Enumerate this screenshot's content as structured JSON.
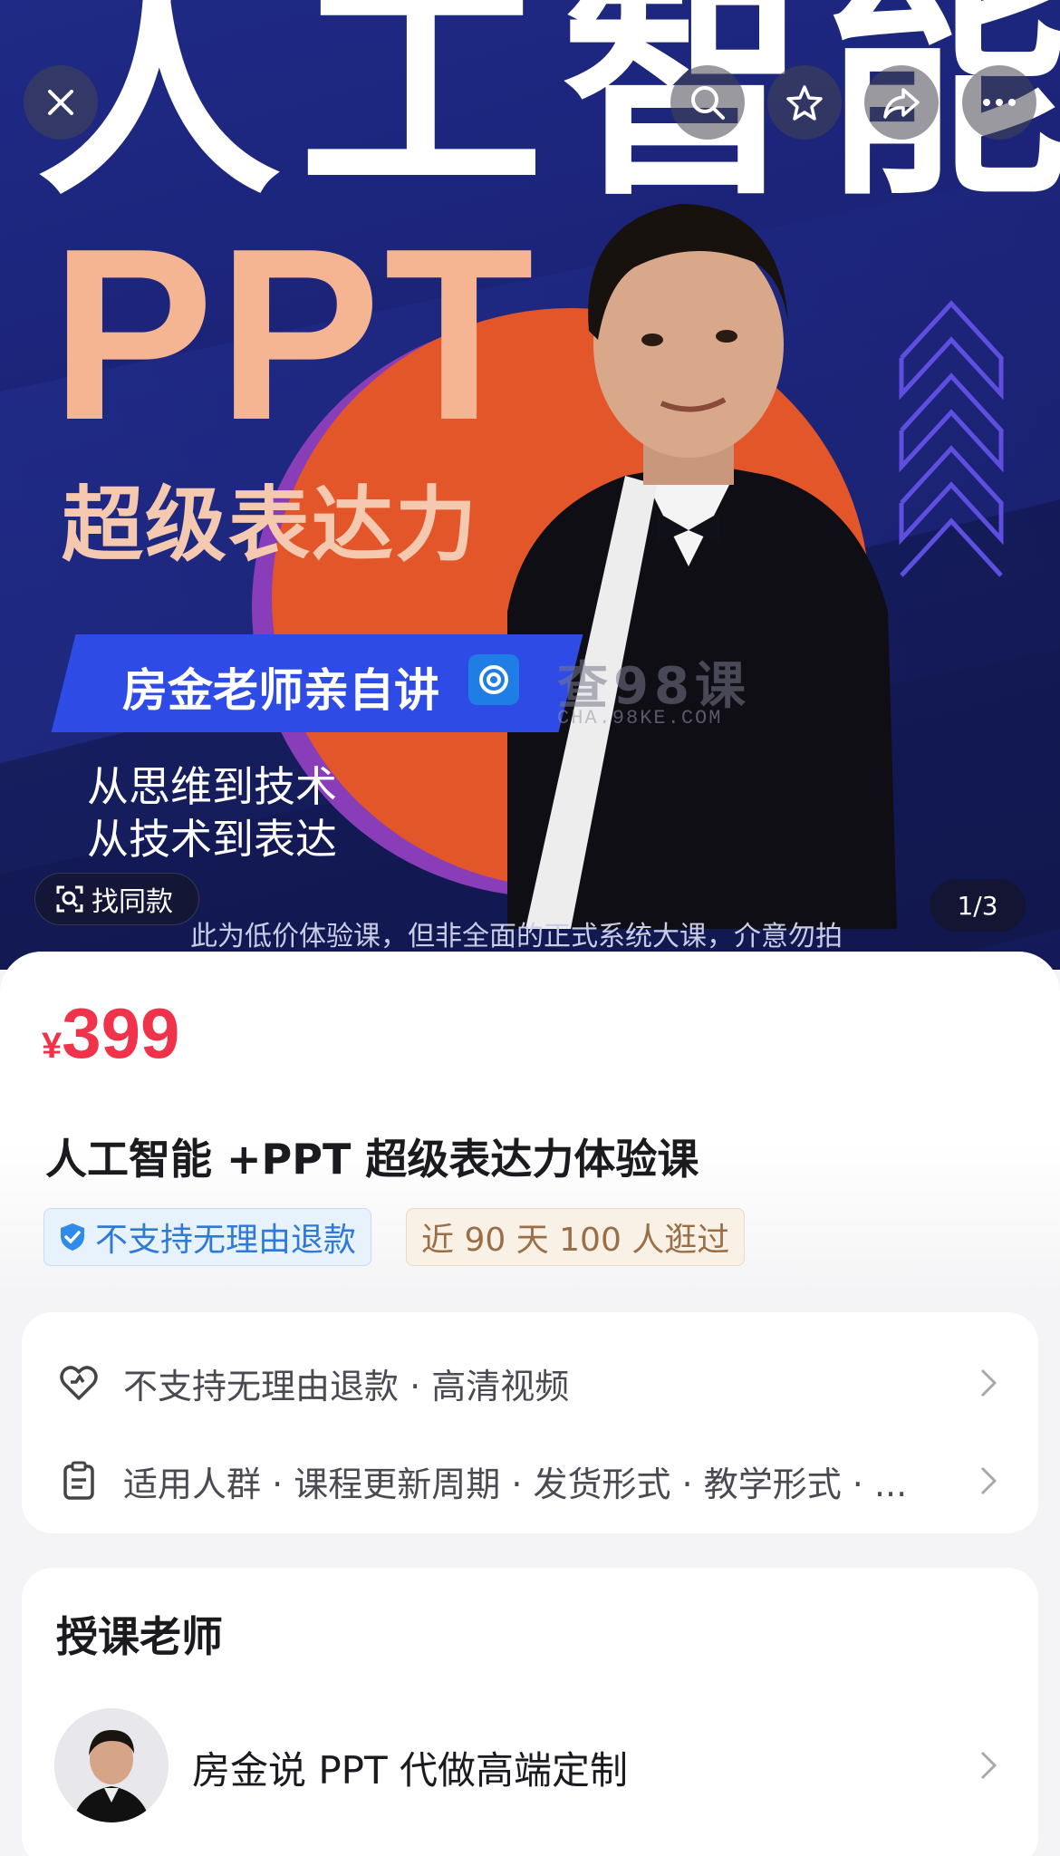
{
  "hero": {
    "big_title": "人工智能",
    "ppt_text": "PPT",
    "subtitle": "超级表达力",
    "banner_text": "房金老师亲自讲",
    "line1": "从思维到技术",
    "line2": "从技术到表达",
    "watermark": "查98课",
    "watermark_url": "CHA.98KE.COM",
    "notice": "此为低价体验课，但非全面的正式系统大课，介意勿拍",
    "find_same_label": "找同款",
    "page_indicator": "1/3"
  },
  "product": {
    "currency": "¥",
    "price": "399",
    "title": "人工智能 +PPT 超级表达力体验课",
    "tag_refund": "不支持无理由退款",
    "tag_visits": "近 90 天 100 人逛过"
  },
  "details": {
    "service_row": "不支持无理由退款 · 高清视频",
    "params_row": "适用人群 · 课程更新周期 · 发货形式 · 教学形式 · ..."
  },
  "teacher": {
    "section_title": "授课老师",
    "name": "房金说 PPT 代做高端定制"
  },
  "colors": {
    "price": "#f0334a",
    "hero_bg": "#1f2a86",
    "accent_orange": "#e2562a",
    "tag_blue": "#2f7ad6"
  }
}
